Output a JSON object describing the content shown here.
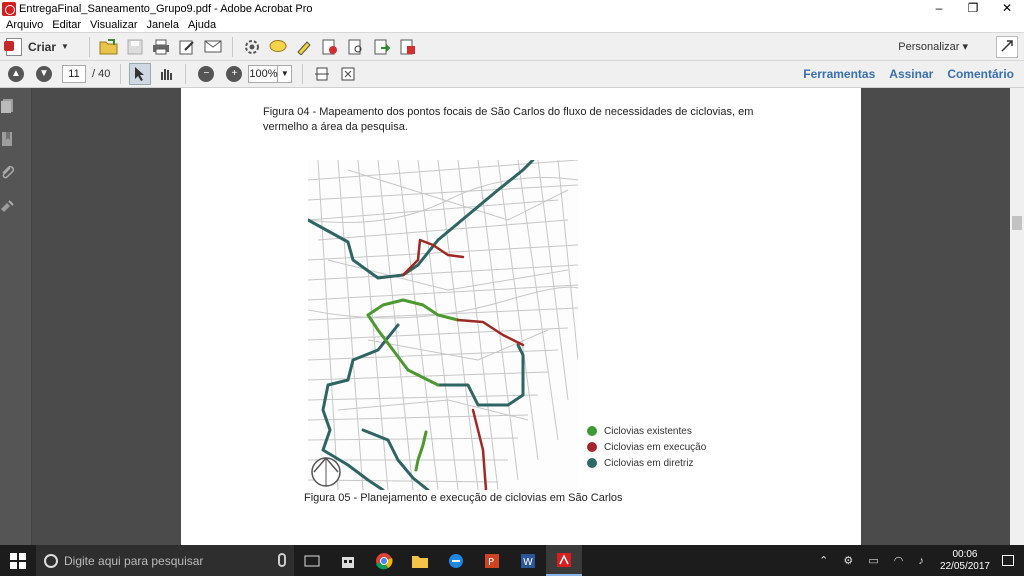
{
  "window": {
    "title": "EntregaFinal_Saneamento_Grupo9.pdf - Adobe Acrobat Pro",
    "minimize": "–",
    "restore": "❐",
    "close": "✕"
  },
  "menu": {
    "items": [
      "Arquivo",
      "Editar",
      "Visualizar",
      "Janela",
      "Ajuda"
    ]
  },
  "toolbar": {
    "criar_label": "Criar",
    "personalizar_label": "Personalizar"
  },
  "nav": {
    "page_current": "11",
    "page_total": "/ 40",
    "zoom": "100%"
  },
  "right_links": {
    "ferramentas": "Ferramentas",
    "assinar": "Assinar",
    "comentario": "Comentário"
  },
  "document": {
    "caption_top": "Figura 04 - Mapeamento dos pontos focais de São Carlos do fluxo de necessidades de ciclovias, em vermelho a área da pesquisa.",
    "caption_bottom": "Figura 05 - Planejamento e execução de ciclovias em São Carlos",
    "legend": [
      {
        "label": "Ciclovias existentes",
        "color": "#3d9a32"
      },
      {
        "label": "Ciclovias em execução",
        "color": "#a3252c"
      },
      {
        "label": "Ciclovias em diretriz",
        "color": "#2e6a6a"
      }
    ],
    "map_colors": {
      "existing": "#4c9a2f",
      "execution": "#9e2a23",
      "guideline": "#2f6464",
      "streets": "#c4c4c4"
    }
  },
  "taskbar": {
    "search_placeholder": "Digite aqui para pesquisar",
    "time": "00:06",
    "date": "22/05/2017"
  }
}
